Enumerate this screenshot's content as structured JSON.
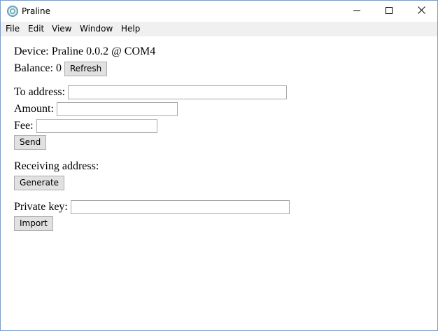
{
  "window": {
    "title": "Praline",
    "app_icon": "praline-app-icon",
    "controls": {
      "minimize_icon": "minimize-icon",
      "maximize_icon": "maximize-icon",
      "close_icon": "close-icon"
    }
  },
  "menubar": {
    "items": [
      {
        "label": "File"
      },
      {
        "label": "Edit"
      },
      {
        "label": "View"
      },
      {
        "label": "Window"
      },
      {
        "label": "Help"
      }
    ]
  },
  "device": {
    "text": "Device: Praline 0.0.2 @ COM4"
  },
  "balance": {
    "label": "Balance: 0",
    "refresh_label": "Refresh"
  },
  "send": {
    "to_address_label": "To address:",
    "to_address_value": "",
    "amount_label": "Amount:",
    "amount_value": "",
    "fee_label": "Fee:",
    "fee_value": "",
    "send_label": "Send"
  },
  "receive": {
    "label": "Receiving address:",
    "generate_label": "Generate"
  },
  "import": {
    "private_key_label": "Private key:",
    "private_key_value": "",
    "import_label": "Import"
  },
  "colors": {
    "window_border": "#7a9cc6",
    "menubar_bg": "#f0f0f0",
    "button_bg": "#e1e1e1",
    "button_border": "#adadad",
    "input_border": "#a9a9a9"
  }
}
